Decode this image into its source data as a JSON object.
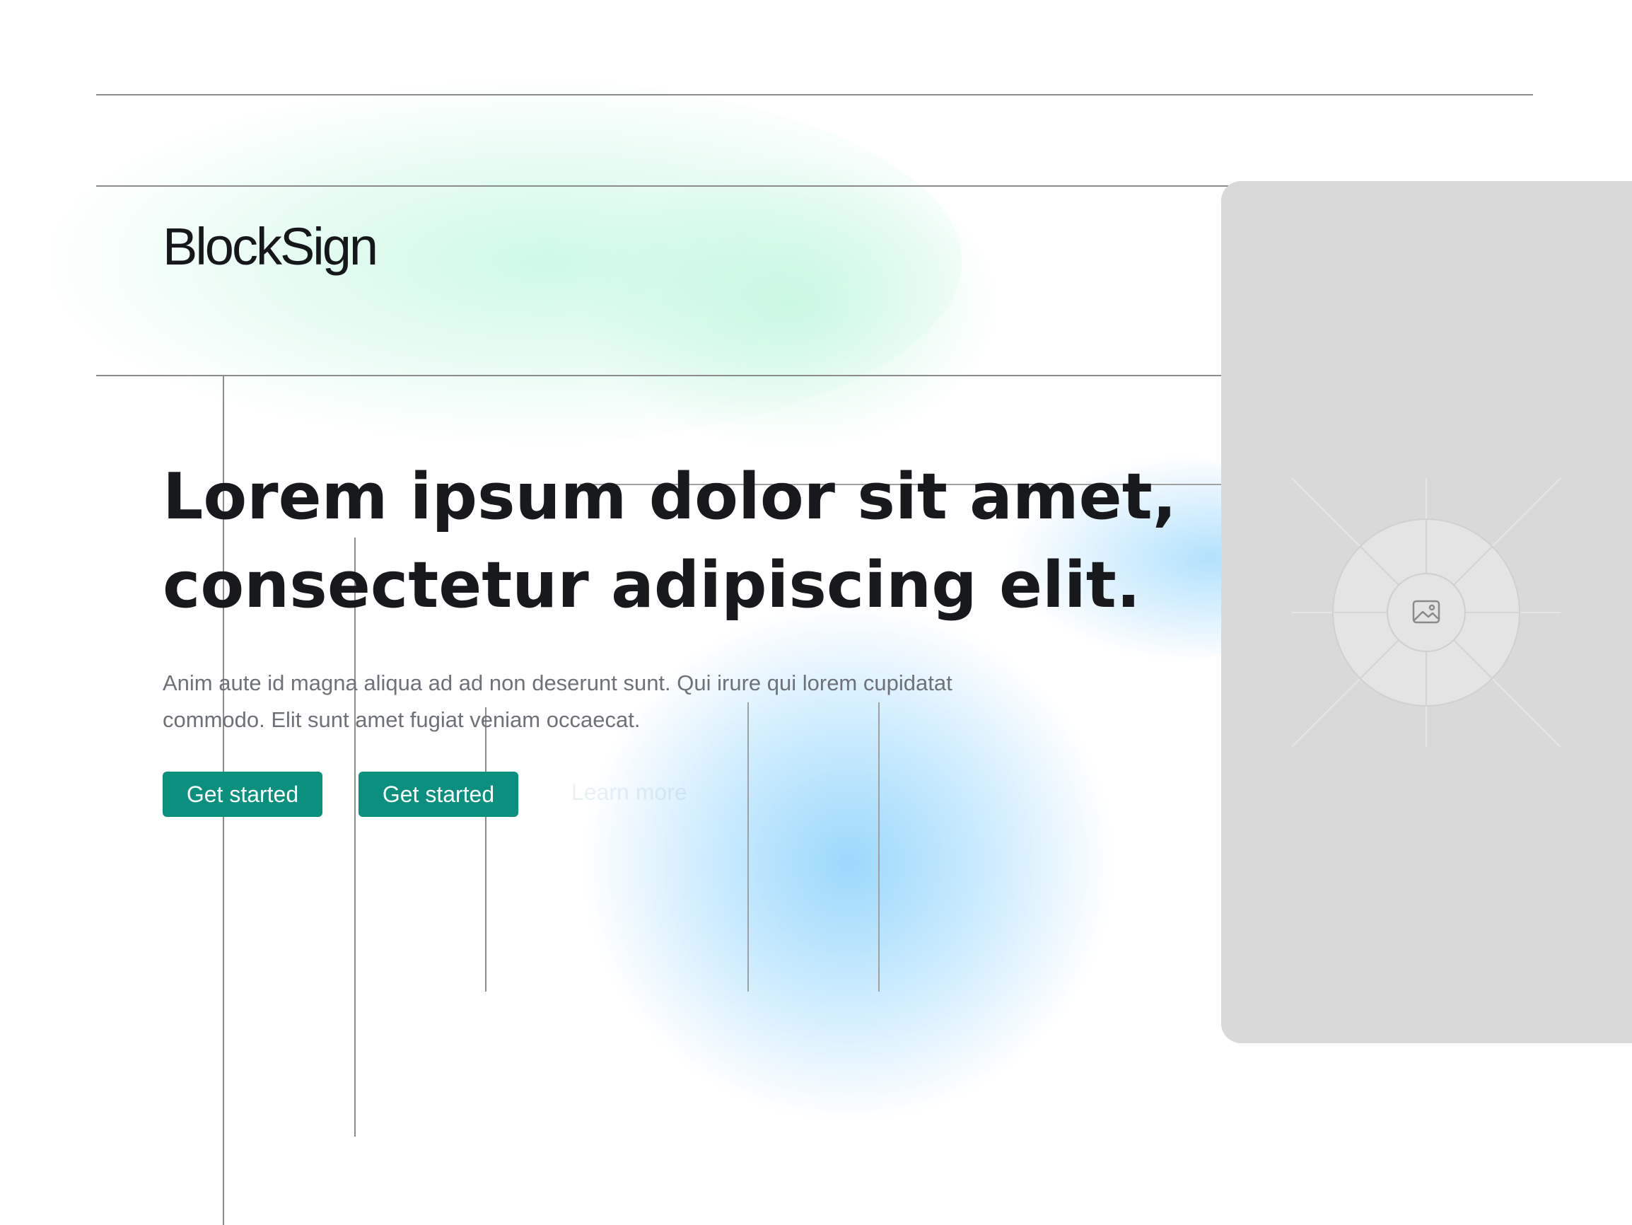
{
  "brand": {
    "name": "BlockSign"
  },
  "hero": {
    "title_line_1": "Lorem ipsum dolor sit amet,",
    "title_line_2": "consectetur adipiscing elit.",
    "subtitle_line_1": "Anim aute id magna aliqua ad ad non deserunt sunt. Qui irure qui lorem cupidatat",
    "subtitle_line_2": "commodo. Elit sunt amet fugiat veniam occaecat."
  },
  "actions": {
    "primary_label": "Get started",
    "secondary_label": "Get started",
    "tertiary_label": "Learn more"
  },
  "media": {
    "placeholder_icon": "image-icon"
  },
  "colors": {
    "accent": "#0b8f7f",
    "heading": "#17191c",
    "body_text": "#6d7278",
    "placeholder": "#d9d9d9",
    "green_glow": "#c6f8e2",
    "blue_glow": "#96d6fc"
  }
}
